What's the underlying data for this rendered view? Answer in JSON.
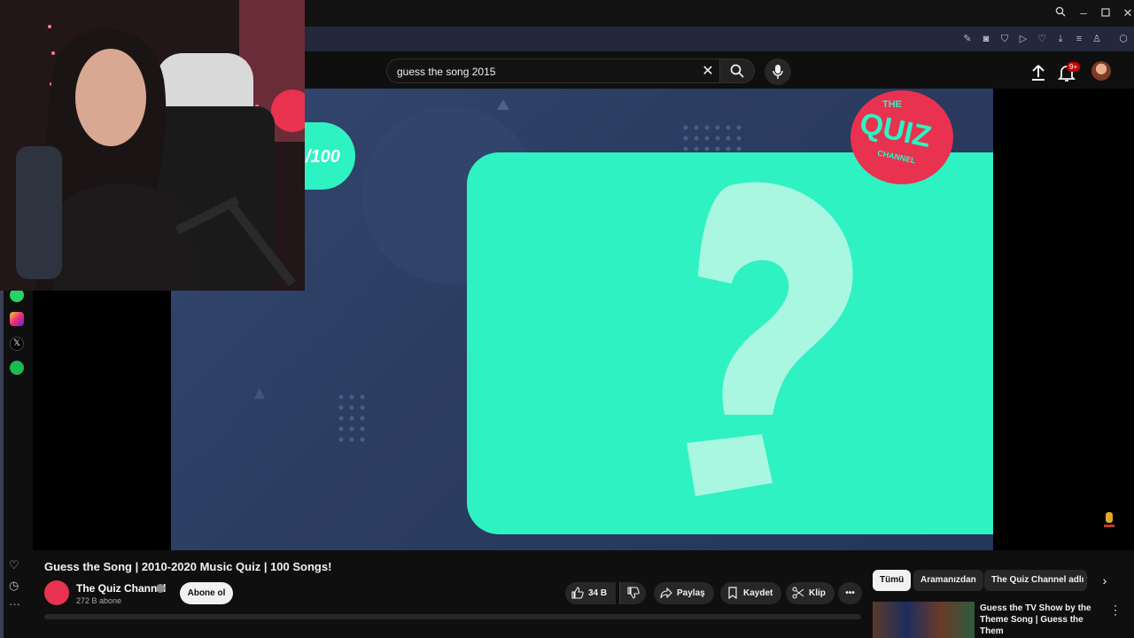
{
  "search": {
    "value": "guess the song 2015"
  },
  "header": {
    "notifications_badge": "9+"
  },
  "video": {
    "title": "Guess the Song | 2010-2020 Music Quiz | 100 Songs!",
    "score_overlay": "/100",
    "logo_text_top": "THE",
    "logo_text_main": "QUIZ",
    "logo_text_bottom": "CHANNEL"
  },
  "channel": {
    "name": "The Quiz Channel",
    "subscribers": "272 B abone",
    "subscribe_label": "Abone ol"
  },
  "actions": {
    "likes": "34 B",
    "share": "Paylaş",
    "save": "Kaydet",
    "clip": "Klip"
  },
  "chips": [
    "Tümü",
    "Aramanızdan",
    "The Quiz Channel adlı yü"
  ],
  "recommendation": {
    "title": "Guess the TV Show by the Theme Song | Guess the Them"
  },
  "colors": {
    "quiz_green": "#2ff2c3",
    "quiz_red": "#e8324f",
    "player_bg": "#2c3d62"
  }
}
